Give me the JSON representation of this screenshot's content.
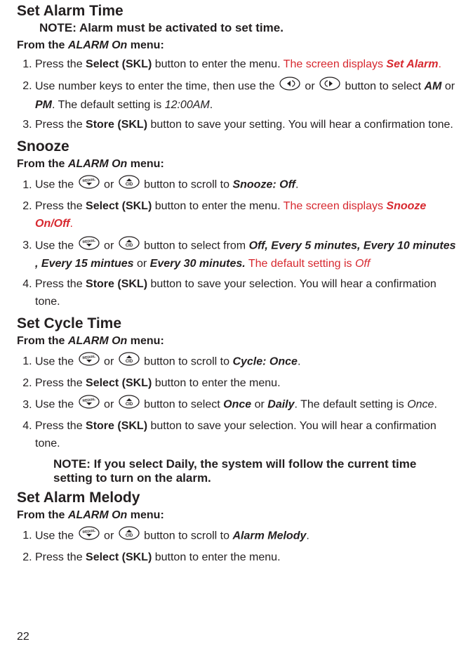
{
  "sections": {
    "setAlarmTime": {
      "title": "Set Alarm Time",
      "note": "NOTE: Alarm must be activated to set time.",
      "from": [
        "From the ",
        "ALARM On",
        " menu:"
      ],
      "steps": [
        {
          "parts": [
            {
              "t": "Press the "
            },
            {
              "t": "Select (SKL)",
              "c": "b"
            },
            {
              "t": " button to enter the menu. "
            },
            {
              "t": "The screen displays ",
              "c": "red"
            },
            {
              "t": "Set Alarm",
              "c": "red bi"
            },
            {
              "t": ".",
              "c": "red"
            }
          ]
        },
        {
          "parts": [
            {
              "t": "Use number keys to enter the time, then use the "
            },
            {
              "icon": "left"
            },
            {
              "t": " or "
            },
            {
              "icon": "right"
            },
            {
              "t": " button to select "
            },
            {
              "t": "AM",
              "c": "bi"
            },
            {
              "t": " or "
            },
            {
              "t": "PM",
              "c": "bi"
            },
            {
              "t": ". The default setting is "
            },
            {
              "t": "12:00AM",
              "c": "i"
            },
            {
              "t": "."
            }
          ]
        },
        {
          "parts": [
            {
              "t": "Press the "
            },
            {
              "t": "Store (SKL)",
              "c": "b"
            },
            {
              "t": " button to save your setting. You will hear a confirmation tone."
            }
          ]
        }
      ]
    },
    "snooze": {
      "title": "Snooze",
      "from": [
        "From the ",
        "ALARM On",
        " menu:"
      ],
      "steps": [
        {
          "parts": [
            {
              "t": "Use the "
            },
            {
              "icon": "down"
            },
            {
              "t": " or "
            },
            {
              "icon": "up"
            },
            {
              "t": " button to scroll to "
            },
            {
              "t": "Snooze: Off",
              "c": "bi"
            },
            {
              "t": "."
            }
          ]
        },
        {
          "parts": [
            {
              "t": "Press the "
            },
            {
              "t": "Select (SKL)",
              "c": "b"
            },
            {
              "t": " button to enter the menu. "
            },
            {
              "t": "The screen displays ",
              "c": "red"
            },
            {
              "t": "Snooze On/Off",
              "c": "red bi"
            },
            {
              "t": ".",
              "c": "red"
            }
          ]
        },
        {
          "parts": [
            {
              "t": "Use the "
            },
            {
              "icon": "down"
            },
            {
              "t": " or "
            },
            {
              "icon": "up"
            },
            {
              "t": " button to select from "
            },
            {
              "t": "Off, Every 5 minutes, Every 10 minutes , Every 15 mintues",
              "c": "bi"
            },
            {
              "t": " or "
            },
            {
              "t": "Every 30 minutes.",
              "c": "bi"
            },
            {
              "t": " The default setting is ",
              "c": "red"
            },
            {
              "t": "Off",
              "c": "red i"
            }
          ]
        },
        {
          "parts": [
            {
              "t": "Press the "
            },
            {
              "t": "Store (SKL)",
              "c": "b"
            },
            {
              "t": " button to save your selection. You will hear a confirmation tone."
            }
          ]
        }
      ]
    },
    "setCycleTime": {
      "title": "Set Cycle Time",
      "from": [
        "From the ",
        "ALARM On",
        " menu:"
      ],
      "steps": [
        {
          "parts": [
            {
              "t": "Use the "
            },
            {
              "icon": "down"
            },
            {
              "t": " or "
            },
            {
              "icon": "up"
            },
            {
              "t": " button to scroll to "
            },
            {
              "t": "Cycle: Once",
              "c": "bi"
            },
            {
              "t": "."
            }
          ]
        },
        {
          "parts": [
            {
              "t": "Press the "
            },
            {
              "t": "Select (SKL)",
              "c": "b"
            },
            {
              "t": " button to enter the menu."
            }
          ]
        },
        {
          "parts": [
            {
              "t": "Use the "
            },
            {
              "icon": "down"
            },
            {
              "t": " or "
            },
            {
              "icon": "up"
            },
            {
              "t": " button to select "
            },
            {
              "t": "Once",
              "c": "bi"
            },
            {
              "t": " or "
            },
            {
              "t": "Daily",
              "c": "bi"
            },
            {
              "t": ". The default setting is "
            },
            {
              "t": "Once",
              "c": "i"
            },
            {
              "t": "."
            }
          ]
        },
        {
          "parts": [
            {
              "t": "Press the "
            },
            {
              "t": "Store (SKL)",
              "c": "b"
            },
            {
              "t": " button to save your selection. You will hear a confirmation tone."
            }
          ]
        }
      ],
      "note": "NOTE: If you select Daily, the system will follow the current time setting to turn on the alarm."
    },
    "setAlarmMelody": {
      "title": "Set Alarm Melody",
      "from": [
        "From the ",
        "ALARM On",
        " menu:"
      ],
      "steps": [
        {
          "parts": [
            {
              "t": "Use the "
            },
            {
              "icon": "down"
            },
            {
              "t": " or "
            },
            {
              "icon": "up"
            },
            {
              "t": " button to scroll to "
            },
            {
              "t": "Alarm Melody",
              "c": "bi"
            },
            {
              "t": "."
            }
          ]
        },
        {
          "parts": [
            {
              "t": "Press the "
            },
            {
              "t": "Select (SKL)",
              "c": "b"
            },
            {
              "t": " button to enter the menu."
            }
          ]
        }
      ]
    }
  },
  "pageNumber": "22"
}
